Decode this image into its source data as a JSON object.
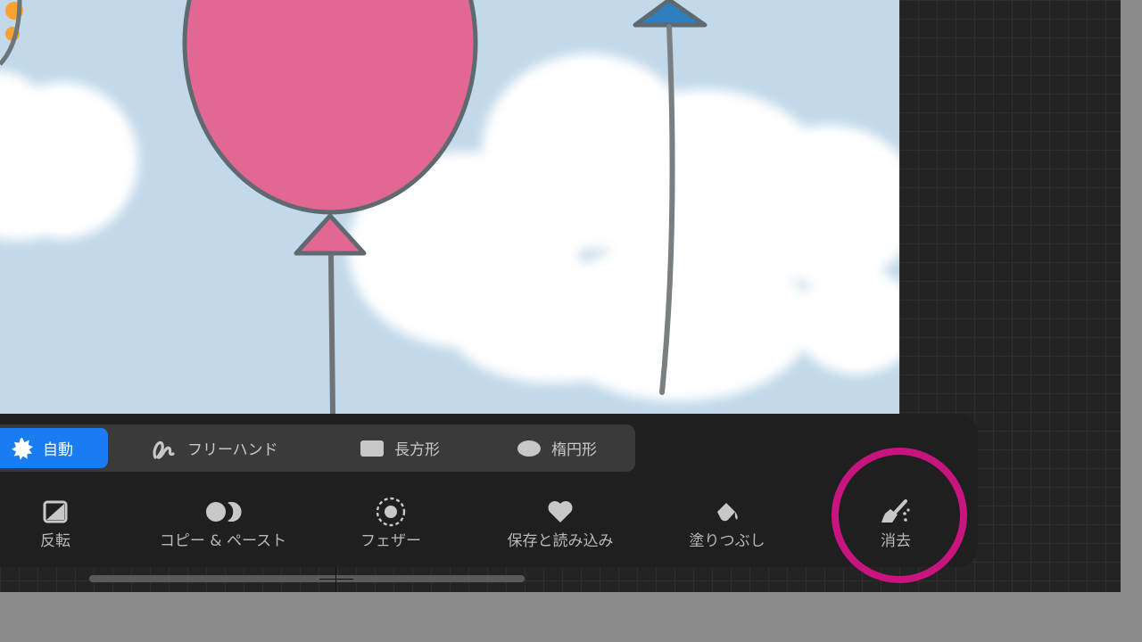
{
  "selection_modes": [
    {
      "label": "自動",
      "icon": "starburst-icon",
      "active": true
    },
    {
      "label": "フリーハンド",
      "icon": "freehand-icon",
      "active": false
    },
    {
      "label": "長方形",
      "icon": "rectangle-icon",
      "active": false
    },
    {
      "label": "楕円形",
      "icon": "ellipse-icon",
      "active": false
    }
  ],
  "tools": [
    {
      "label": "反転",
      "icon": "invert-icon"
    },
    {
      "label": "コピー & ペースト",
      "icon": "copy-paste-icon"
    },
    {
      "label": "フェザー",
      "icon": "feather-icon"
    },
    {
      "label": "保存と読み込み",
      "icon": "heart-icon"
    },
    {
      "label": "塗りつぶし",
      "icon": "fill-bucket-icon"
    },
    {
      "label": "消去",
      "icon": "brush-clear-icon"
    }
  ],
  "colors": {
    "accent": "#1a7cf2",
    "highlight_ring": "#c8147e",
    "balloon_pink": "#e26893",
    "balloon_blue": "#2e7fc0",
    "sky": "#c1d9ea",
    "dot_orange": "#f7a233"
  }
}
